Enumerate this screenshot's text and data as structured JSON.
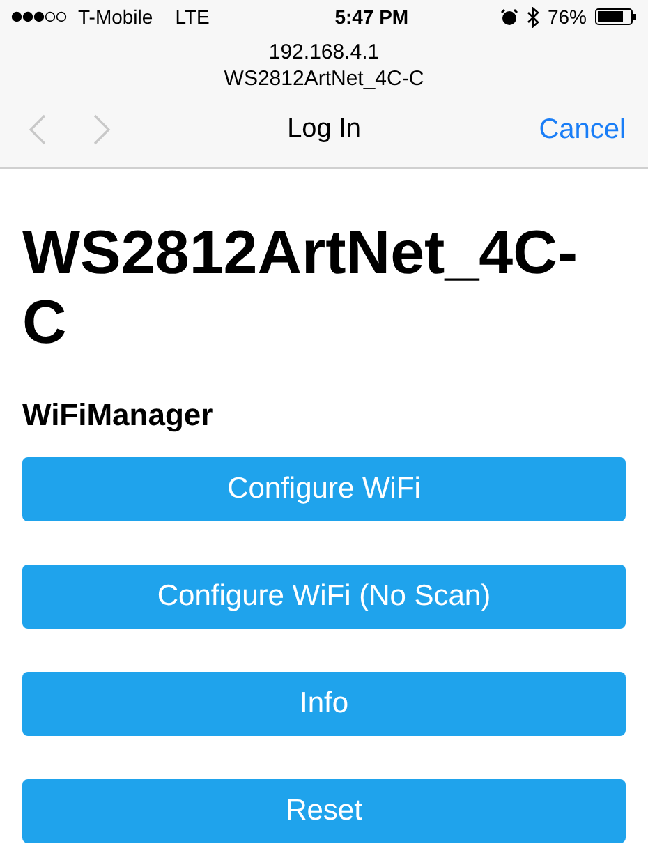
{
  "status_bar": {
    "carrier": "T-Mobile",
    "network": "LTE",
    "time": "5:47 PM",
    "battery": "76%"
  },
  "address": {
    "host": "192.168.4.1",
    "title": "WS2812ArtNet_4C-C"
  },
  "nav": {
    "back_disabled": true,
    "forward_disabled": true,
    "title": "Log In",
    "action": "Cancel"
  },
  "page": {
    "heading": "WS2812ArtNet_4C-C",
    "subheading": "WiFiManager",
    "buttons": [
      "Configure WiFi",
      "Configure WiFi (No Scan)",
      "Info",
      "Reset"
    ]
  }
}
